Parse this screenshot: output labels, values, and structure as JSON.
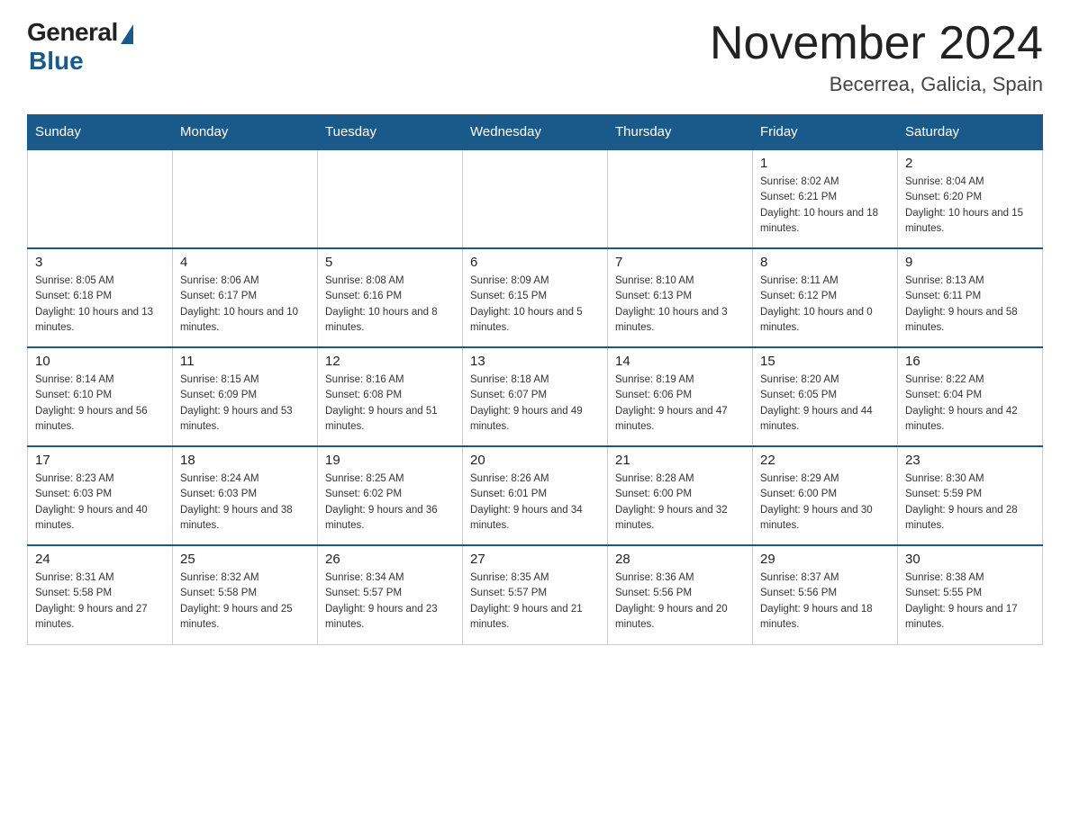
{
  "header": {
    "logo_general": "General",
    "logo_blue": "Blue",
    "month_title": "November 2024",
    "location": "Becerrea, Galicia, Spain"
  },
  "weekdays": [
    "Sunday",
    "Monday",
    "Tuesday",
    "Wednesday",
    "Thursday",
    "Friday",
    "Saturday"
  ],
  "weeks": [
    [
      {
        "day": "",
        "sunrise": "",
        "sunset": "",
        "daylight": ""
      },
      {
        "day": "",
        "sunrise": "",
        "sunset": "",
        "daylight": ""
      },
      {
        "day": "",
        "sunrise": "",
        "sunset": "",
        "daylight": ""
      },
      {
        "day": "",
        "sunrise": "",
        "sunset": "",
        "daylight": ""
      },
      {
        "day": "",
        "sunrise": "",
        "sunset": "",
        "daylight": ""
      },
      {
        "day": "1",
        "sunrise": "Sunrise: 8:02 AM",
        "sunset": "Sunset: 6:21 PM",
        "daylight": "Daylight: 10 hours and 18 minutes."
      },
      {
        "day": "2",
        "sunrise": "Sunrise: 8:04 AM",
        "sunset": "Sunset: 6:20 PM",
        "daylight": "Daylight: 10 hours and 15 minutes."
      }
    ],
    [
      {
        "day": "3",
        "sunrise": "Sunrise: 8:05 AM",
        "sunset": "Sunset: 6:18 PM",
        "daylight": "Daylight: 10 hours and 13 minutes."
      },
      {
        "day": "4",
        "sunrise": "Sunrise: 8:06 AM",
        "sunset": "Sunset: 6:17 PM",
        "daylight": "Daylight: 10 hours and 10 minutes."
      },
      {
        "day": "5",
        "sunrise": "Sunrise: 8:08 AM",
        "sunset": "Sunset: 6:16 PM",
        "daylight": "Daylight: 10 hours and 8 minutes."
      },
      {
        "day": "6",
        "sunrise": "Sunrise: 8:09 AM",
        "sunset": "Sunset: 6:15 PM",
        "daylight": "Daylight: 10 hours and 5 minutes."
      },
      {
        "day": "7",
        "sunrise": "Sunrise: 8:10 AM",
        "sunset": "Sunset: 6:13 PM",
        "daylight": "Daylight: 10 hours and 3 minutes."
      },
      {
        "day": "8",
        "sunrise": "Sunrise: 8:11 AM",
        "sunset": "Sunset: 6:12 PM",
        "daylight": "Daylight: 10 hours and 0 minutes."
      },
      {
        "day": "9",
        "sunrise": "Sunrise: 8:13 AM",
        "sunset": "Sunset: 6:11 PM",
        "daylight": "Daylight: 9 hours and 58 minutes."
      }
    ],
    [
      {
        "day": "10",
        "sunrise": "Sunrise: 8:14 AM",
        "sunset": "Sunset: 6:10 PM",
        "daylight": "Daylight: 9 hours and 56 minutes."
      },
      {
        "day": "11",
        "sunrise": "Sunrise: 8:15 AM",
        "sunset": "Sunset: 6:09 PM",
        "daylight": "Daylight: 9 hours and 53 minutes."
      },
      {
        "day": "12",
        "sunrise": "Sunrise: 8:16 AM",
        "sunset": "Sunset: 6:08 PM",
        "daylight": "Daylight: 9 hours and 51 minutes."
      },
      {
        "day": "13",
        "sunrise": "Sunrise: 8:18 AM",
        "sunset": "Sunset: 6:07 PM",
        "daylight": "Daylight: 9 hours and 49 minutes."
      },
      {
        "day": "14",
        "sunrise": "Sunrise: 8:19 AM",
        "sunset": "Sunset: 6:06 PM",
        "daylight": "Daylight: 9 hours and 47 minutes."
      },
      {
        "day": "15",
        "sunrise": "Sunrise: 8:20 AM",
        "sunset": "Sunset: 6:05 PM",
        "daylight": "Daylight: 9 hours and 44 minutes."
      },
      {
        "day": "16",
        "sunrise": "Sunrise: 8:22 AM",
        "sunset": "Sunset: 6:04 PM",
        "daylight": "Daylight: 9 hours and 42 minutes."
      }
    ],
    [
      {
        "day": "17",
        "sunrise": "Sunrise: 8:23 AM",
        "sunset": "Sunset: 6:03 PM",
        "daylight": "Daylight: 9 hours and 40 minutes."
      },
      {
        "day": "18",
        "sunrise": "Sunrise: 8:24 AM",
        "sunset": "Sunset: 6:03 PM",
        "daylight": "Daylight: 9 hours and 38 minutes."
      },
      {
        "day": "19",
        "sunrise": "Sunrise: 8:25 AM",
        "sunset": "Sunset: 6:02 PM",
        "daylight": "Daylight: 9 hours and 36 minutes."
      },
      {
        "day": "20",
        "sunrise": "Sunrise: 8:26 AM",
        "sunset": "Sunset: 6:01 PM",
        "daylight": "Daylight: 9 hours and 34 minutes."
      },
      {
        "day": "21",
        "sunrise": "Sunrise: 8:28 AM",
        "sunset": "Sunset: 6:00 PM",
        "daylight": "Daylight: 9 hours and 32 minutes."
      },
      {
        "day": "22",
        "sunrise": "Sunrise: 8:29 AM",
        "sunset": "Sunset: 6:00 PM",
        "daylight": "Daylight: 9 hours and 30 minutes."
      },
      {
        "day": "23",
        "sunrise": "Sunrise: 8:30 AM",
        "sunset": "Sunset: 5:59 PM",
        "daylight": "Daylight: 9 hours and 28 minutes."
      }
    ],
    [
      {
        "day": "24",
        "sunrise": "Sunrise: 8:31 AM",
        "sunset": "Sunset: 5:58 PM",
        "daylight": "Daylight: 9 hours and 27 minutes."
      },
      {
        "day": "25",
        "sunrise": "Sunrise: 8:32 AM",
        "sunset": "Sunset: 5:58 PM",
        "daylight": "Daylight: 9 hours and 25 minutes."
      },
      {
        "day": "26",
        "sunrise": "Sunrise: 8:34 AM",
        "sunset": "Sunset: 5:57 PM",
        "daylight": "Daylight: 9 hours and 23 minutes."
      },
      {
        "day": "27",
        "sunrise": "Sunrise: 8:35 AM",
        "sunset": "Sunset: 5:57 PM",
        "daylight": "Daylight: 9 hours and 21 minutes."
      },
      {
        "day": "28",
        "sunrise": "Sunrise: 8:36 AM",
        "sunset": "Sunset: 5:56 PM",
        "daylight": "Daylight: 9 hours and 20 minutes."
      },
      {
        "day": "29",
        "sunrise": "Sunrise: 8:37 AM",
        "sunset": "Sunset: 5:56 PM",
        "daylight": "Daylight: 9 hours and 18 minutes."
      },
      {
        "day": "30",
        "sunrise": "Sunrise: 8:38 AM",
        "sunset": "Sunset: 5:55 PM",
        "daylight": "Daylight: 9 hours and 17 minutes."
      }
    ]
  ]
}
